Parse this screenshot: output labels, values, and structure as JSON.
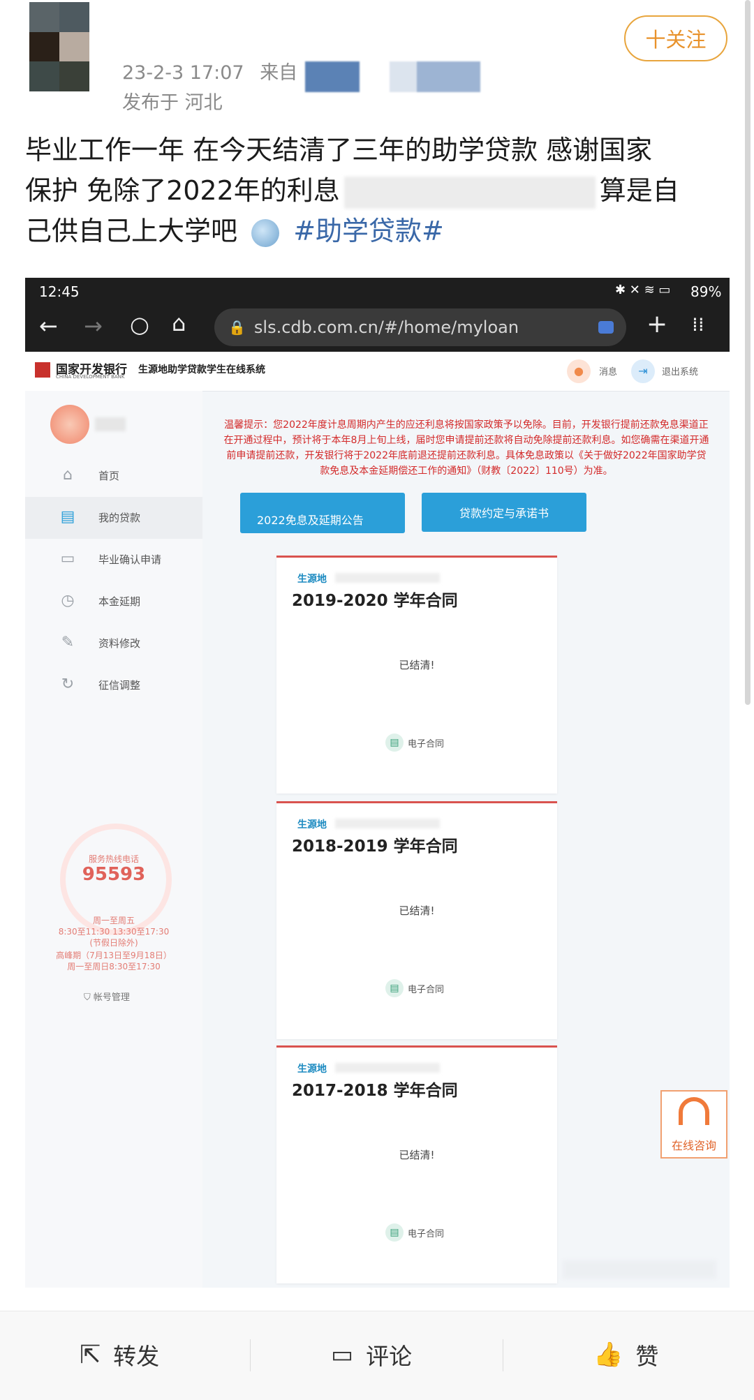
{
  "post": {
    "timestamp": "23-2-3 17:07",
    "source_prefix": "来自",
    "location": "发布于 河北",
    "follow_label": "十关注",
    "text_line1": "毕业工作一年 在今天结清了三年的助学贷款 感谢国家",
    "text_line2_a": "保护 免除了2022年的利息",
    "text_line2_b": "算是自",
    "text_line3": "己供自己上大学吧",
    "hashtag": "#助学贷款#"
  },
  "phone": {
    "time": "12:45",
    "battery": "89%",
    "url": "sls.cdb.com.cn/#/home/myloan"
  },
  "site": {
    "bank_name": "国家开发银行",
    "bank_name_en": "CHINA DEVELOPMENT BANK",
    "system_name": "生源地助学贷款学生在线系统",
    "messages_label": "消息",
    "logout_label": "退出系统",
    "notice": "温馨提示：您2022年度计息周期内产生的应还利息将按国家政策予以免除。目前，开发银行提前还款免息渠道正在开通过程中，预计将于本年8月上旬上线，届时您申请提前还款将自动免除提前还款利息。如您确需在渠道开通前申请提前还款，开发银行将于2022年底前退还提前还款利息。具体免息政策以《关于做好2022年国家助学贷款免息及本金延期偿还工作的通知》（财教〔2022〕110号）为准。",
    "btn_announcement": "2022免息及延期公告",
    "btn_agreement": "贷款约定与承诺书"
  },
  "sidebar": {
    "items": [
      {
        "label": "首页",
        "icon": "home-icon"
      },
      {
        "label": "我的贷款",
        "icon": "list-icon"
      },
      {
        "label": "毕业确认申请",
        "icon": "inbox-icon"
      },
      {
        "label": "本金延期",
        "icon": "clock-icon"
      },
      {
        "label": "资料修改",
        "icon": "edit-icon"
      },
      {
        "label": "征信调整",
        "icon": "refresh-icon"
      }
    ],
    "hotline_label": "服务热线电话",
    "hotline_number": "95593",
    "hours_1": "周一至周五",
    "hours_2": "8:30至11:30 13:30至17:30",
    "hours_3": "(节假日除外)",
    "hours_4": "高峰期（7月13日至9月18日）",
    "hours_5": "周一至周日8:30至17:30",
    "account_manage": "帐号管理"
  },
  "contracts": [
    {
      "source": "生源地",
      "title": "2019-2020 学年合同",
      "status": "已结清!",
      "econtract": "电子合同"
    },
    {
      "source": "生源地",
      "title": "2018-2019 学年合同",
      "status": "已结清!",
      "econtract": "电子合同"
    },
    {
      "source": "生源地",
      "title": "2017-2018 学年合同",
      "status": "已结清!",
      "econtract": "电子合同"
    }
  ],
  "consult_label": "在线咨询",
  "bottom": {
    "repost": "转发",
    "comment": "评论",
    "like": "赞"
  },
  "colors": {
    "follow_border": "#e8a53d",
    "hashtag": "#3a68a8",
    "notice_red": "#d32a2a",
    "button_blue": "#2b9fd9",
    "card_top": "#d9534f"
  }
}
